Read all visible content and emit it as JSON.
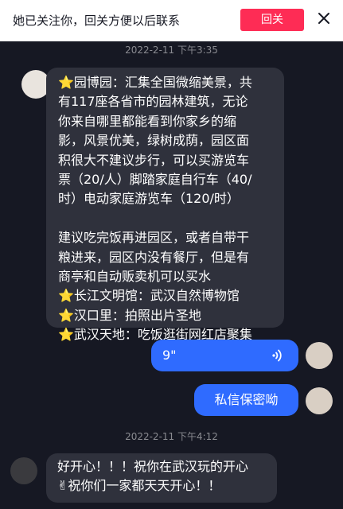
{
  "banner": {
    "text": "她已关注你，回关方便以后联系",
    "follow_back_label": "回关",
    "close_icon": "close-icon"
  },
  "messages": [
    {
      "time": "2022-2-11 下午3:35",
      "from": "them",
      "lines": [
        "⭐园博园：汇集全国微缩美景，共",
        "有117座各省市的园林建筑，无论",
        "你来自哪里都能看到你家乡的缩",
        "影，风景优美，绿树成荫，园区面",
        "积很大不建议步行，可以买游览车",
        "票（20/人）脚踏家庭自行车（40/",
        "时）电动家庭游览车（120/时）",
        "",
        "建议吃完饭再进园区，或者自带干",
        "粮进来，园区内没有餐厅，但是有",
        "商亭和自动贩卖机可以买水",
        "⭐长江文明馆：武汉自然博物馆",
        "⭐汉口里：拍照出片圣地",
        "⭐武汉天地：吃饭逛街网红店聚集"
      ]
    },
    {
      "from": "me",
      "type": "voice",
      "duration": "9\"",
      "icon": "voice-wave-icon"
    },
    {
      "from": "me",
      "text": "私信保密呦"
    },
    {
      "time": "2022-2-11 下午4:12",
      "from": "them",
      "lines": [
        "好开心！！！祝你在武汉玩的开心",
        "✌祝你们一家都天天开心！！"
      ]
    }
  ],
  "colors": {
    "background": "#161823",
    "received_bubble": "#2f313c",
    "sent_bubble": "#2f6bff",
    "follow_button": "#fe2c55",
    "timestamp": "#8a8b91"
  }
}
